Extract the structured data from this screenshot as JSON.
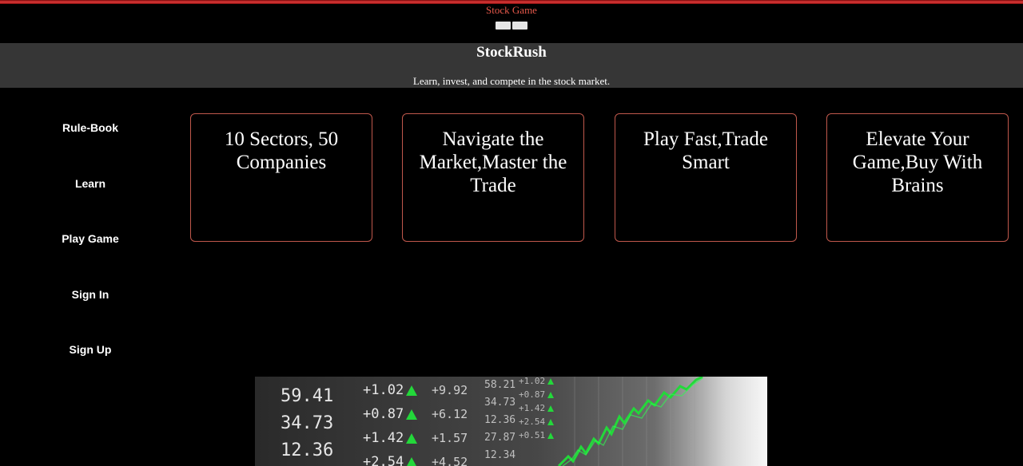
{
  "site": {
    "title": "Stock Game"
  },
  "header": {
    "brand": "StockRush",
    "tagline": "Learn, invest, and compete in the stock market."
  },
  "sidebar": {
    "items": [
      {
        "label": "Rule-Book"
      },
      {
        "label": "Learn"
      },
      {
        "label": "Play Game"
      },
      {
        "label": "Sign In"
      },
      {
        "label": "Sign Up"
      }
    ]
  },
  "cards": [
    {
      "text": "10 Sectors, 50 Companies"
    },
    {
      "text": "Navigate the Market,Master the Trade"
    },
    {
      "text": "Play Fast,Trade Smart"
    },
    {
      "text": "Elevate Your Game,Buy With Brains"
    }
  ],
  "hero_image": {
    "prices": [
      "59.41",
      "34.73",
      "12.36"
    ],
    "changes": [
      "+1.02",
      "+0.87",
      "+1.42",
      "+2.54"
    ],
    "deltas": [
      "+9.92",
      "+6.12",
      "+1.57",
      "+4.52"
    ],
    "small_prices": [
      "58.21",
      "34.73",
      "12.36",
      "27.87",
      "12.34"
    ],
    "tiny_changes": [
      "+1.02",
      "+0.87",
      "+1.42",
      "+2.54",
      "+0.51"
    ]
  },
  "colors": {
    "accent_red": "#e23a3a",
    "title_orange": "#e5584a",
    "card_border": "#c0584c",
    "header_band": "#363636",
    "chart_green": "#23d83a"
  }
}
